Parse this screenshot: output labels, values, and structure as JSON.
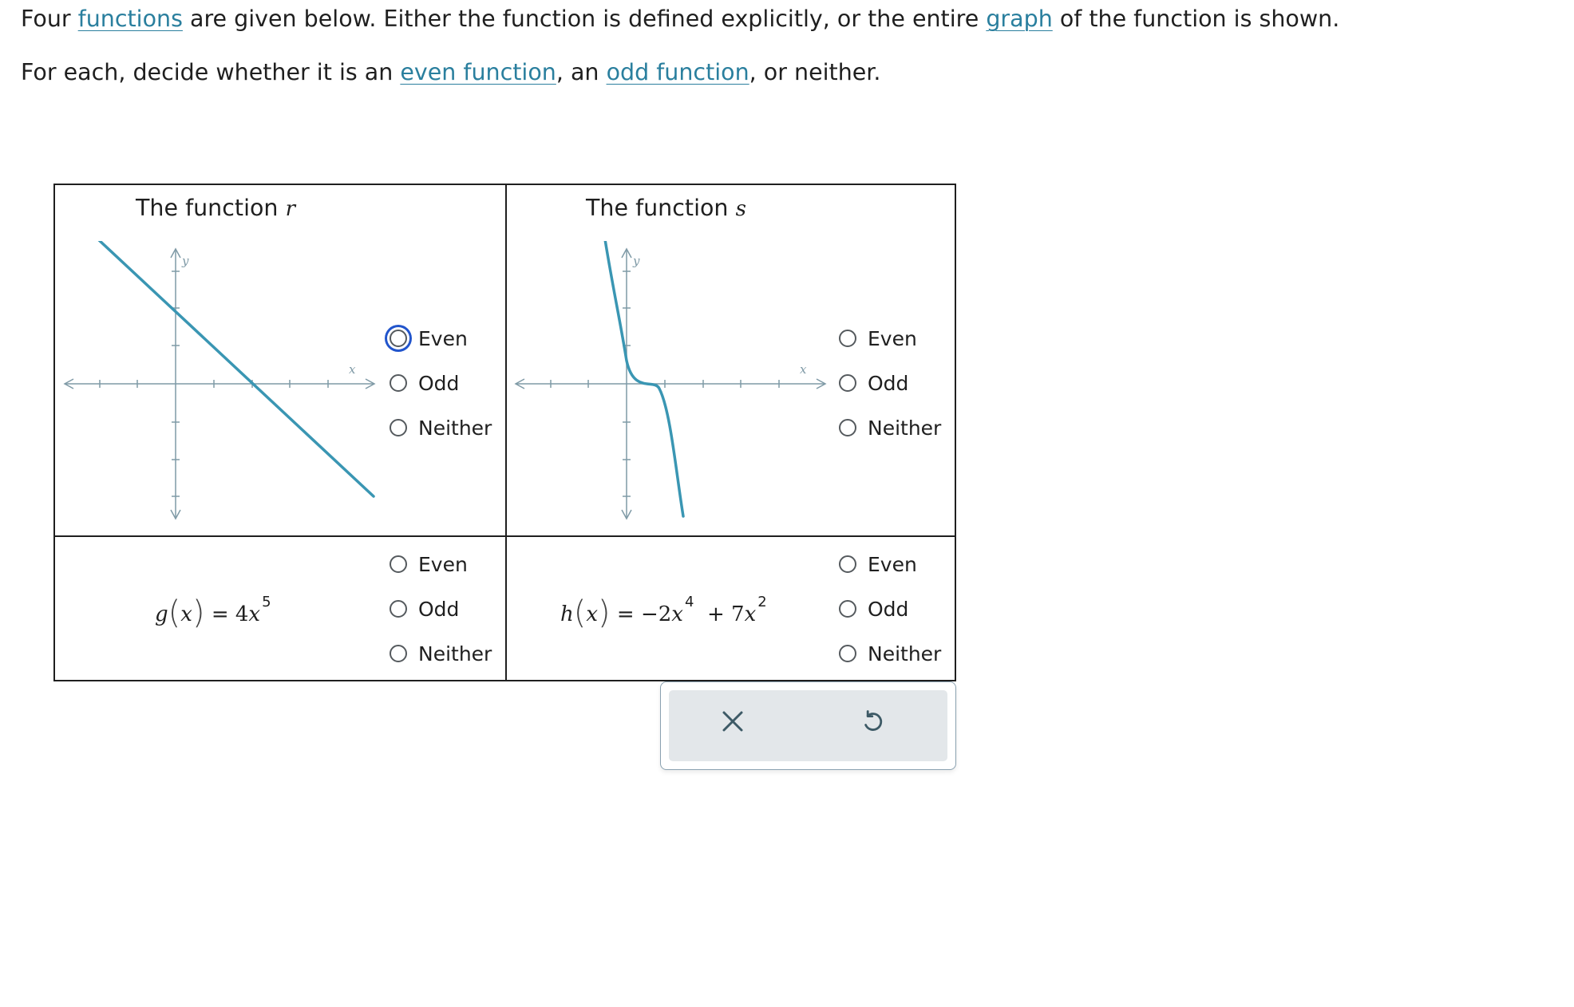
{
  "intro": {
    "line1": {
      "t1": "Four ",
      "link1": "functions",
      "t2": " are given below. Either the function is defined explicitly, or the entire ",
      "link2": "graph",
      "t3": " of the function is shown."
    },
    "line2": {
      "t1": "For each, decide whether it is an ",
      "link1": "even function",
      "t2": ", an ",
      "link2": "odd function",
      "t3": ", or neither."
    }
  },
  "cells": {
    "r": {
      "title_prefix": "The function",
      "name": "r",
      "choices": [
        "Even",
        "Odd",
        "Neither"
      ],
      "focused_choice": "Even"
    },
    "s": {
      "title_prefix": "The function",
      "name": "s",
      "choices": [
        "Even",
        "Odd",
        "Neither"
      ]
    },
    "g": {
      "fname": "g",
      "var": "x",
      "eq": "=",
      "coef": "4",
      "xvar": "x",
      "exp": "5",
      "choices": [
        "Even",
        "Odd",
        "Neither"
      ]
    },
    "h": {
      "fname": "h",
      "var": "x",
      "eq": "=",
      "term1_coef": "−2",
      "term1_var": "x",
      "term1_exp": "4",
      "op": "+",
      "term2_coef": "7",
      "term2_var": "x",
      "term2_exp": "2",
      "choices": [
        "Even",
        "Odd",
        "Neither"
      ]
    }
  },
  "graph_labels": {
    "x": "x",
    "y": "y"
  },
  "toolbar": {
    "clear_icon": "close-icon",
    "undo_icon": "undo-icon"
  },
  "colors": {
    "link": "#2a7f9e",
    "curve": "#3a96b3",
    "axis": "#7f9aa6",
    "focus": "#2255cc",
    "toolbar_bg": "#e3e7ea"
  }
}
